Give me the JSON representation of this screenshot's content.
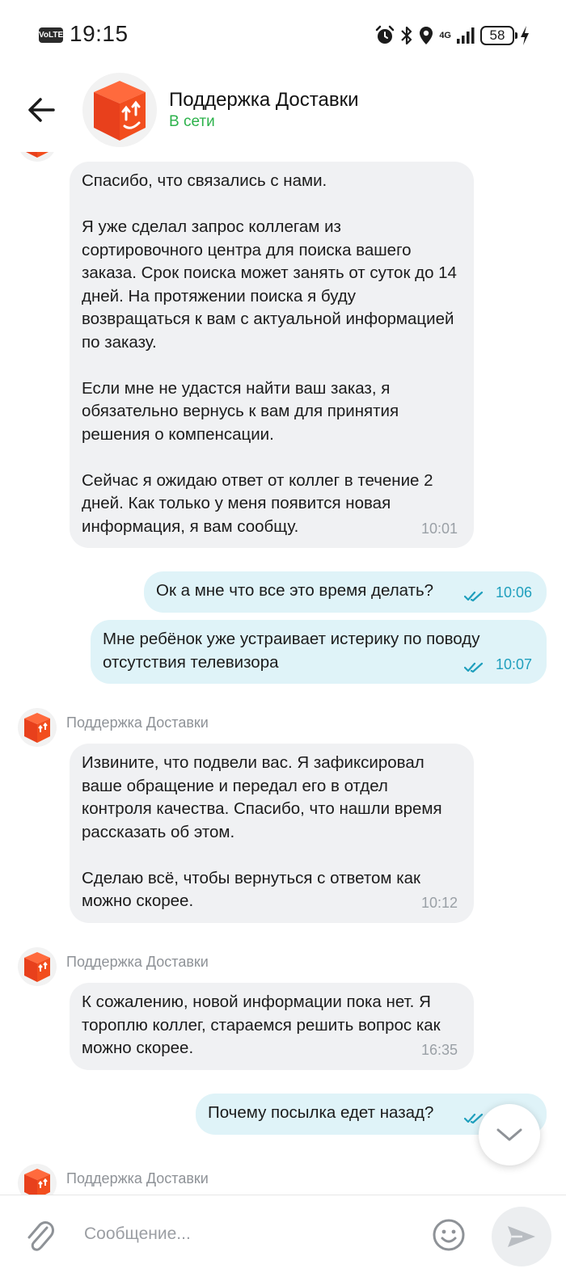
{
  "status_bar": {
    "volte": "VoLTE",
    "time": "19:15",
    "network": "4G",
    "battery": "58"
  },
  "header": {
    "title": "Поддержка Доставки",
    "status": "В сети"
  },
  "messages": [
    {
      "direction": "incoming",
      "text": "Спасибо, что связались с нами.\n\nЯ уже сделал запрос коллегам из сортировочного центра для поиска вашего заказа. Срок поиска может занять от суток до 14 дней. На протяжении поиска я буду возвращаться к вам с актуальной информацией по заказу.\n\nЕсли мне не удастся найти ваш заказ, я обязательно вернусь к вам для принятия решения о компенсации.\n\nСейчас я ожидаю ответ от коллег в течение 2 дней. Как только у меня появится новая информация, я вам сообщу.",
      "time": "10:01"
    },
    {
      "direction": "outgoing",
      "text": "Ок а мне что все это время делать?",
      "time": "10:06"
    },
    {
      "direction": "outgoing",
      "text": "Мне ребёнок уже устраивает истерику по поводу отсутствия телевизора",
      "time": "10:07"
    },
    {
      "direction": "incoming",
      "sender": "Поддержка Доставки",
      "text": "Извините, что подвели вас. Я зафиксировал ваше обращение и передал его в отдел контроля качества. Спасибо, что нашли время рассказать об этом.\n\nСделаю всё, чтобы вернуться с ответом как можно скорее.",
      "time": "10:12"
    },
    {
      "direction": "incoming",
      "sender": "Поддержка Доставки",
      "text": "К сожалению, новой информации пока нет. Я тороплю коллег, стараемся решить вопрос как можно скорее.",
      "time": "16:35"
    },
    {
      "direction": "outgoing",
      "text": "Почему посылка едет назад?",
      "time": ""
    },
    {
      "direction": "incoming",
      "sender": "Поддержка Доставки"
    }
  ],
  "composer": {
    "placeholder": "Сообщение..."
  },
  "icons": {
    "back": "arrow-left-icon",
    "attach": "paperclip-icon",
    "emoji": "smiley-icon",
    "send": "send-icon",
    "scroll": "chevron-down-icon",
    "read": "double-check-icon"
  },
  "colors": {
    "brand": "#f24e1e",
    "online": "#2cb24b",
    "outgoing_bubble": "#dff3f8",
    "incoming_bubble": "#f0f1f3",
    "read_ticks": "#1f9fbd"
  }
}
